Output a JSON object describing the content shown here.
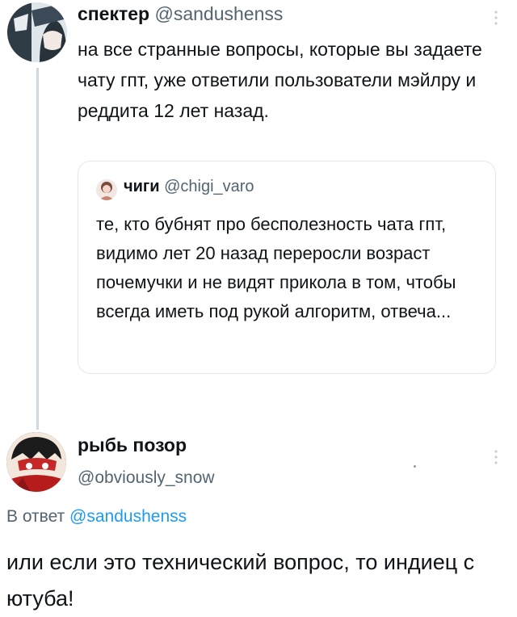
{
  "tweet1": {
    "display_name": "спектер",
    "handle": "@sandushenss",
    "text": "на все странные вопросы, которые вы задаете чату гпт, уже ответили пользователи мэйлру и реддита 12 лет назад.",
    "more_icon": "more-vertical-icon"
  },
  "quote": {
    "display_name": "чиги",
    "handle": "@chigi_varo",
    "text": "те, кто бубнят про бесполезность чата гпт, видимо лет 20 назад переросли возраст почемучки и не видят прикола в том, чтобы всегда иметь под рукой алгоритм, отвеча..."
  },
  "tweet2": {
    "display_name": "рыбь позор",
    "handle": "@obviously_snow",
    "reply_prefix": "В ответ",
    "reply_mention": "@sandushenss",
    "text": "или если это технический вопрос, то индиец с ютуба!",
    "more_icon": "more-vertical-icon"
  },
  "colors": {
    "handle": "#536471",
    "mention": "#1d9bf0",
    "thread_line": "#cfd9de",
    "quote_border": "#e1e8ed"
  }
}
